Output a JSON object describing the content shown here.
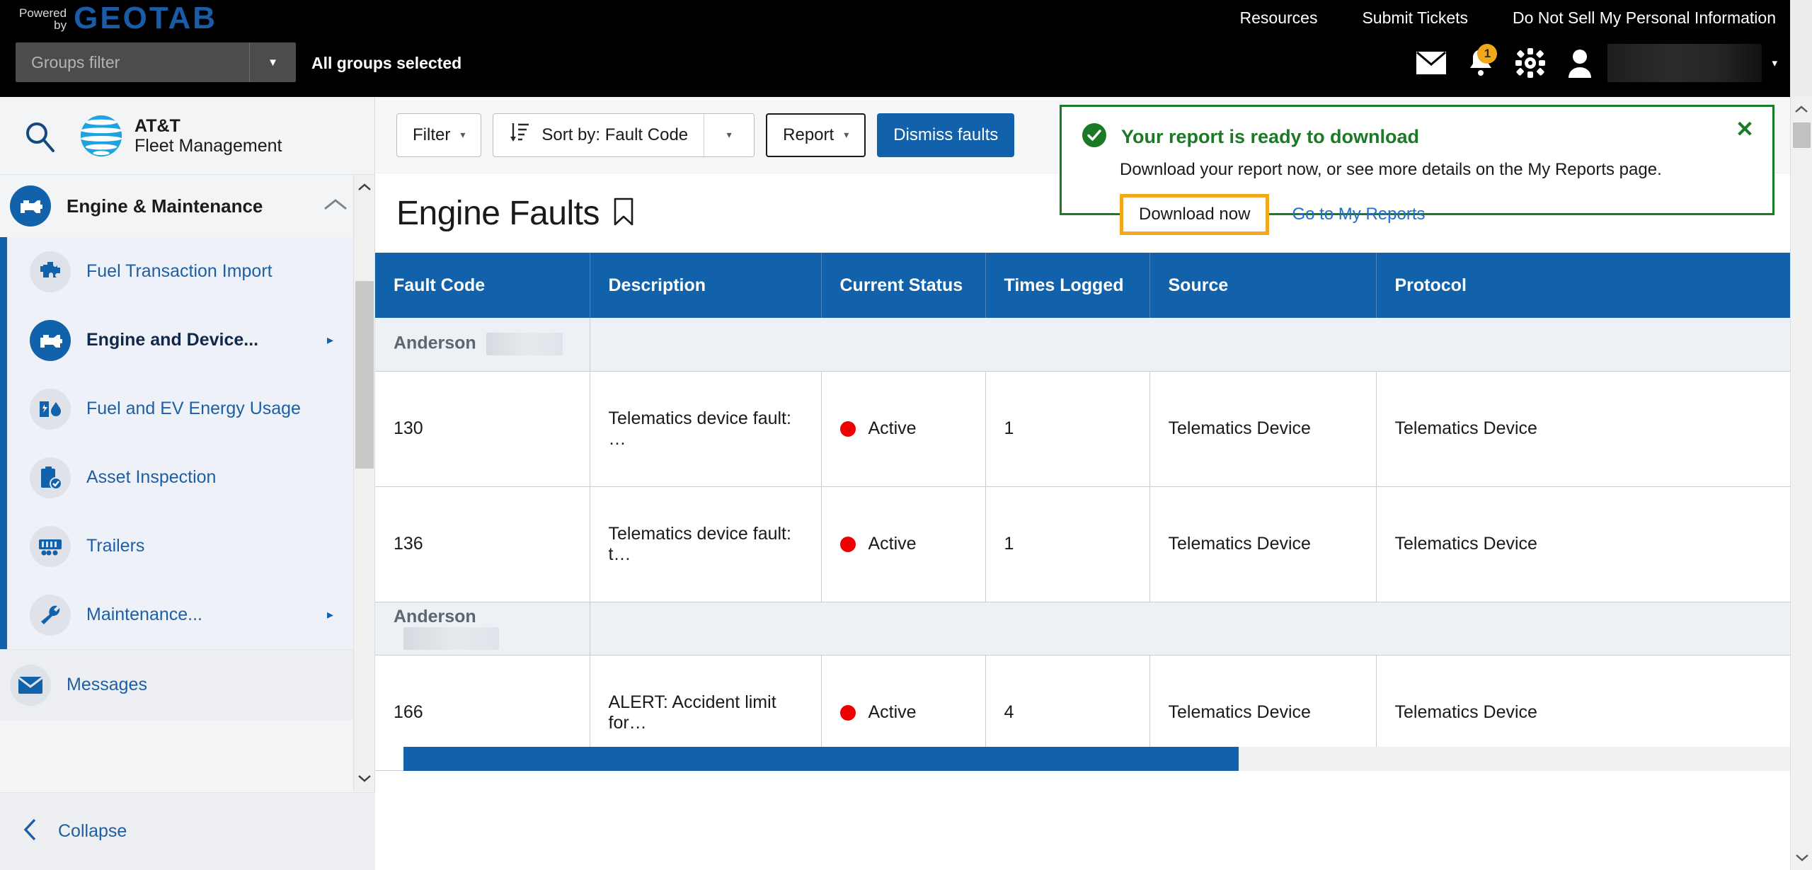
{
  "header": {
    "powered_by_line1": "Powered",
    "powered_by_line2": "by",
    "brand_logo": "GEOTAB",
    "groups_filter_placeholder": "Groups filter",
    "groups_filter_value": "",
    "all_groups_status": "All groups selected",
    "links": [
      {
        "label": "Resources"
      },
      {
        "label": "Submit Tickets"
      },
      {
        "label": "Do Not Sell My Personal Information"
      }
    ],
    "icons": [
      {
        "name": "mail-icon",
        "badge": ""
      },
      {
        "name": "bell-icon",
        "badge": "1"
      },
      {
        "name": "gear-icon",
        "badge": ""
      },
      {
        "name": "user-icon",
        "badge": ""
      }
    ],
    "user_name_redacted": "",
    "user_caret": "▾"
  },
  "sidebar": {
    "search_icon": "search-icon",
    "brand_line1": "AT&T",
    "brand_line2": "Fleet Management",
    "group": {
      "label": "Engine & Maintenance",
      "expanded_caret": "˄"
    },
    "items": [
      {
        "label": "Fuel Transaction Import",
        "icon": "puzzle-icon",
        "has_submenu": false,
        "active": false
      },
      {
        "label": "Engine and Device...",
        "icon": "engine-icon",
        "has_submenu": true,
        "active": true
      },
      {
        "label": "Fuel and EV Energy Usage",
        "icon": "fuel-ev-icon",
        "has_submenu": false,
        "active": false
      },
      {
        "label": "Asset Inspection",
        "icon": "clipboard-check-icon",
        "has_submenu": false,
        "active": false
      },
      {
        "label": "Trailers",
        "icon": "trailer-icon",
        "has_submenu": false,
        "active": false
      },
      {
        "label": "Maintenance...",
        "icon": "wrench-icon",
        "has_submenu": true,
        "active": false
      }
    ],
    "messages_label": "Messages",
    "messages_icon": "envelope-icon",
    "collapse_label": "Collapse",
    "collapse_icon": "chevron-left-icon"
  },
  "toolbar": {
    "filter_label": "Filter",
    "filter_caret": "▾",
    "sort_icon": "sort-ascending-icon",
    "sort_label": "Sort by:  Fault Code",
    "sort_caret": "▾",
    "report_label": "Report",
    "report_caret": "▾",
    "dismiss_label": "Dismiss faults"
  },
  "page": {
    "title": "Engine Faults",
    "bookmark_icon": "bookmark-icon"
  },
  "table": {
    "columns": [
      "Fault Code",
      "Description",
      "Current Status",
      "Times Logged",
      "Source",
      "Protocol"
    ],
    "rows": [
      {
        "type": "group",
        "label": "Anderson",
        "redacted_width": 108
      },
      {
        "type": "data",
        "fault_code": "130",
        "description": "Telematics device fault: …",
        "status": "Active",
        "status_color": "#ee0000",
        "times_logged": "1",
        "source": "Telematics Device",
        "protocol": "Telematics Device"
      },
      {
        "type": "data",
        "fault_code": "136",
        "description": "Telematics device fault: t…",
        "status": "Active",
        "status_color": "#ee0000",
        "times_logged": "1",
        "source": "Telematics Device",
        "protocol": "Telematics Device"
      },
      {
        "type": "group",
        "label": "Anderson",
        "redacted_width": 135
      },
      {
        "type": "data",
        "fault_code": "166",
        "description": "ALERT: Accident limit for…",
        "status": "Active",
        "status_color": "#ee0000",
        "times_logged": "4",
        "source": "Telematics Device",
        "protocol": "Telematics Device"
      }
    ]
  },
  "toast": {
    "status_icon": "check-circle-icon",
    "title": "Your report is ready to download",
    "body": "Download your report now, or see more details on the My Reports page.",
    "primary_label": "Download now",
    "secondary_label": "Go to My Reports",
    "close_icon": "close-icon",
    "close_glyph": "✕",
    "accent_color": "#1b7a26",
    "highlight_color": "#f2a81d"
  },
  "colors": {
    "brand_blue": "#1261ab",
    "geotab_blue": "#1a5ca8",
    "header_black": "#000000",
    "status_red": "#ee0000",
    "success_green": "#1b7a26",
    "highlight_orange": "#f2a81d"
  }
}
